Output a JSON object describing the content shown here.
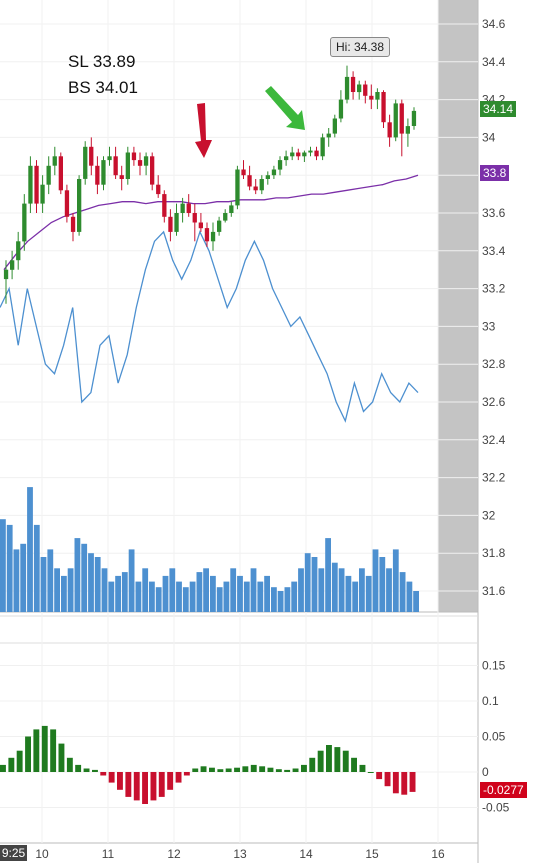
{
  "annotations": {
    "sl": "SL 33.89",
    "bs": "BS 34.01",
    "hi": "Hi: 34.38",
    "time": "9:25"
  },
  "badges": {
    "last_price": "34.14",
    "ma_value": "33.8",
    "osc_value": "-0.0277"
  },
  "colors": {
    "up": "#2e8b2e",
    "down": "#c8102e",
    "ma": "#7b2fa8",
    "volume": "#4d90d0",
    "line": "#4d90d0",
    "osc_up": "#1f7a1f",
    "osc_down": "#c8102e",
    "arrow_red": "#c8102e",
    "arrow_green": "#3cb83c",
    "last_price_bg": "#2e8b2e",
    "ma_bg": "#7b2fa8",
    "osc_bg": "#d0021b"
  },
  "chart_data": [
    {
      "type": "candlestick",
      "x_ticks": [
        "10",
        "11",
        "12",
        "13",
        "14",
        "15",
        "16"
      ],
      "y_ticks": [
        "34.6",
        "34.4",
        "34.2",
        "34",
        "33.8",
        "33.6",
        "33.4",
        "33.2",
        "33",
        "32.8",
        "32.6",
        "32.4",
        "32.2",
        "32",
        "31.8",
        "31.6"
      ],
      "ylim": [
        31.5,
        34.7
      ],
      "hi": 34.38,
      "last": 34.14,
      "ohlc": [
        [
          33.25,
          33.35,
          33.12,
          33.3
        ],
        [
          33.3,
          33.4,
          33.25,
          33.35
        ],
        [
          33.35,
          33.5,
          33.3,
          33.45
        ],
        [
          33.45,
          33.7,
          33.4,
          33.65
        ],
        [
          33.65,
          33.9,
          33.6,
          33.85
        ],
        [
          33.85,
          33.88,
          33.6,
          33.65
        ],
        [
          33.65,
          33.8,
          33.6,
          33.75
        ],
        [
          33.75,
          33.9,
          33.7,
          33.85
        ],
        [
          33.85,
          33.95,
          33.8,
          33.9
        ],
        [
          33.9,
          33.92,
          33.7,
          33.72
        ],
        [
          33.72,
          33.75,
          33.55,
          33.58
        ],
        [
          33.58,
          33.6,
          33.45,
          33.5
        ],
        [
          33.5,
          33.8,
          33.48,
          33.78
        ],
        [
          33.78,
          33.98,
          33.75,
          33.95
        ],
        [
          33.95,
          34.0,
          33.8,
          33.85
        ],
        [
          33.85,
          33.9,
          33.7,
          33.75
        ],
        [
          33.75,
          33.9,
          33.72,
          33.88
        ],
        [
          33.88,
          33.95,
          33.85,
          33.9
        ],
        [
          33.9,
          33.95,
          33.78,
          33.8
        ],
        [
          33.8,
          33.85,
          33.72,
          33.78
        ],
        [
          33.78,
          33.95,
          33.75,
          33.92
        ],
        [
          33.92,
          33.95,
          33.85,
          33.88
        ],
        [
          33.88,
          33.92,
          33.8,
          33.85
        ],
        [
          33.85,
          33.92,
          33.8,
          33.9
        ],
        [
          33.9,
          33.92,
          33.72,
          33.75
        ],
        [
          33.75,
          33.8,
          33.68,
          33.7
        ],
        [
          33.7,
          33.72,
          33.55,
          33.58
        ],
        [
          33.58,
          33.62,
          33.45,
          33.5
        ],
        [
          33.5,
          33.65,
          33.48,
          33.6
        ],
        [
          33.6,
          33.68,
          33.55,
          33.65
        ],
        [
          33.65,
          33.7,
          33.58,
          33.6
        ],
        [
          33.6,
          33.65,
          33.45,
          33.55
        ],
        [
          33.55,
          33.6,
          33.5,
          33.52
        ],
        [
          33.52,
          33.55,
          33.42,
          33.45
        ],
        [
          33.45,
          33.55,
          33.4,
          33.5
        ],
        [
          33.5,
          33.58,
          33.48,
          33.56
        ],
        [
          33.56,
          33.62,
          33.55,
          33.6
        ],
        [
          33.6,
          33.66,
          33.58,
          33.64
        ],
        [
          33.64,
          33.85,
          33.62,
          33.83
        ],
        [
          33.83,
          33.88,
          33.78,
          33.8
        ],
        [
          33.8,
          33.85,
          33.72,
          33.74
        ],
        [
          33.74,
          33.78,
          33.7,
          33.72
        ],
        [
          33.72,
          33.8,
          33.7,
          33.78
        ],
        [
          33.78,
          33.82,
          33.75,
          33.8
        ],
        [
          33.8,
          33.85,
          33.78,
          33.83
        ],
        [
          33.83,
          33.9,
          33.8,
          33.88
        ],
        [
          33.88,
          33.93,
          33.85,
          33.9
        ],
        [
          33.9,
          33.95,
          33.88,
          33.92
        ],
        [
          33.92,
          33.94,
          33.88,
          33.9
        ],
        [
          33.9,
          33.93,
          33.87,
          33.92
        ],
        [
          33.92,
          33.95,
          33.9,
          33.93
        ],
        [
          33.93,
          33.95,
          33.88,
          33.9
        ],
        [
          33.9,
          34.02,
          33.88,
          34.0
        ],
        [
          34.0,
          34.05,
          33.95,
          34.02
        ],
        [
          34.02,
          34.12,
          34.0,
          34.1
        ],
        [
          34.1,
          34.25,
          34.08,
          34.2
        ],
        [
          34.2,
          34.38,
          34.18,
          34.32
        ],
        [
          34.32,
          34.35,
          34.2,
          34.24
        ],
        [
          34.24,
          34.3,
          34.2,
          34.28
        ],
        [
          34.28,
          34.3,
          34.18,
          34.22
        ],
        [
          34.22,
          34.28,
          34.15,
          34.2
        ],
        [
          34.2,
          34.26,
          34.15,
          34.24
        ],
        [
          34.24,
          34.25,
          34.05,
          34.08
        ],
        [
          34.08,
          34.12,
          33.95,
          34.0
        ],
        [
          34.0,
          34.2,
          33.98,
          34.18
        ],
        [
          34.18,
          34.2,
          33.9,
          34.02
        ],
        [
          34.02,
          34.1,
          33.95,
          34.06
        ],
        [
          34.06,
          34.16,
          34.04,
          34.14
        ]
      ],
      "ma": [
        33.3,
        33.38,
        33.45,
        33.5,
        33.55,
        33.58,
        33.6,
        33.62,
        33.64,
        33.65,
        33.66,
        33.66,
        33.65,
        33.66,
        33.66,
        33.66,
        33.65,
        33.65,
        33.66,
        33.66,
        33.67,
        33.67,
        33.67,
        33.68,
        33.68,
        33.69,
        33.7,
        33.7,
        33.71,
        33.72,
        33.73,
        33.74,
        33.75,
        33.77,
        33.78,
        33.8
      ],
      "line": [
        33.1,
        33.2,
        32.9,
        33.2,
        33.0,
        32.8,
        32.75,
        32.9,
        33.1,
        32.6,
        32.65,
        32.9,
        32.95,
        32.7,
        32.85,
        33.1,
        33.3,
        33.45,
        33.5,
        33.35,
        33.25,
        33.35,
        33.5,
        33.4,
        33.25,
        33.1,
        33.2,
        33.35,
        33.45,
        33.35,
        33.2,
        33.1,
        33.0,
        33.05,
        32.95,
        32.85,
        32.75,
        32.6,
        32.5,
        32.7,
        32.55,
        32.6,
        32.75,
        32.65,
        32.6,
        32.7,
        32.65
      ],
      "volume": [
        31.98,
        31.95,
        31.82,
        31.85,
        32.15,
        31.95,
        31.78,
        31.82,
        31.72,
        31.68,
        31.72,
        31.88,
        31.85,
        31.8,
        31.78,
        31.72,
        31.65,
        31.68,
        31.7,
        31.82,
        31.65,
        31.72,
        31.65,
        31.62,
        31.68,
        31.72,
        31.65,
        31.62,
        31.65,
        31.7,
        31.72,
        31.68,
        31.62,
        31.65,
        31.72,
        31.68,
        31.65,
        31.72,
        31.65,
        31.68,
        31.62,
        31.6,
        31.62,
        31.65,
        31.72,
        31.8,
        31.78,
        31.72,
        31.88,
        31.75,
        31.72,
        31.68,
        31.65,
        31.72,
        31.68,
        31.82,
        31.78,
        31.72,
        31.82,
        31.7,
        31.65,
        31.6
      ]
    },
    {
      "type": "bar",
      "y_ticks": [
        "0.15",
        "0.1",
        "0.05",
        "0",
        "-0.05"
      ],
      "ylim": [
        -0.07,
        0.17
      ],
      "values": [
        0.01,
        0.02,
        0.03,
        0.05,
        0.06,
        0.065,
        0.06,
        0.04,
        0.02,
        0.01,
        0.005,
        0.003,
        -0.005,
        -0.015,
        -0.025,
        -0.035,
        -0.04,
        -0.045,
        -0.04,
        -0.035,
        -0.025,
        -0.015,
        -0.005,
        0.005,
        0.008,
        0.006,
        0.004,
        0.005,
        0.006,
        0.008,
        0.01,
        0.008,
        0.006,
        0.004,
        0.003,
        0.005,
        0.01,
        0.02,
        0.03,
        0.038,
        0.035,
        0.03,
        0.02,
        0.01,
        0.0,
        -0.01,
        -0.02,
        -0.03,
        -0.032,
        -0.028
      ]
    }
  ]
}
